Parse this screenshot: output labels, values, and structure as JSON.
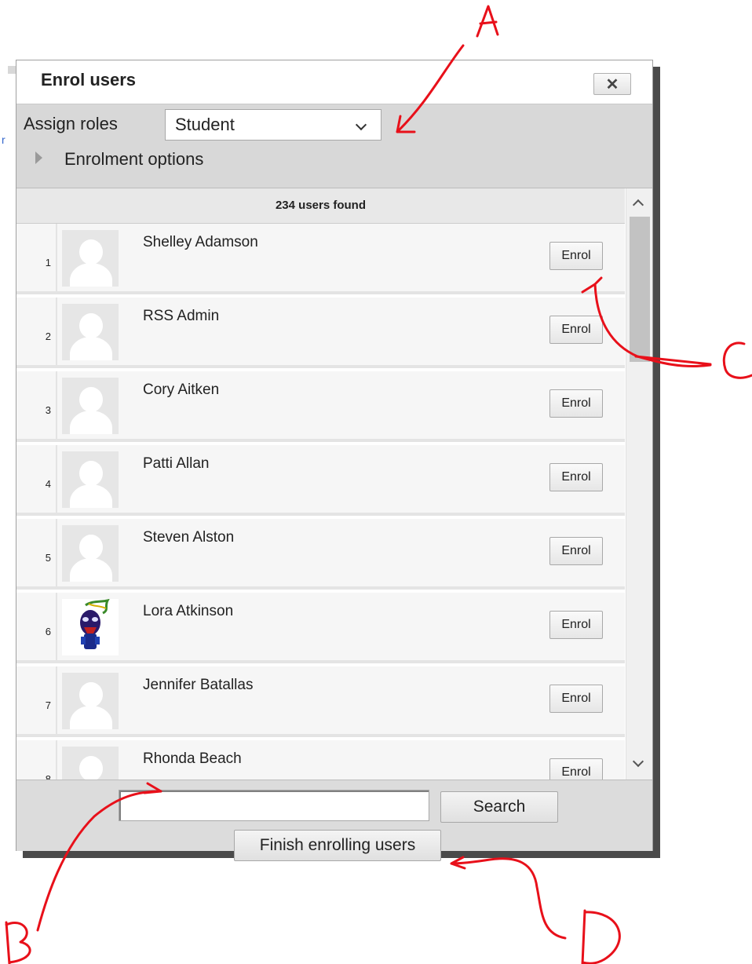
{
  "dialog": {
    "title": "Enrol users",
    "close_label": "✕"
  },
  "options": {
    "roles_label": "Assign roles",
    "roles_selected": "Student",
    "enrolment_options_label": "Enrolment options"
  },
  "list": {
    "found_label": "234 users found",
    "enrol_label": "Enrol",
    "users": [
      {
        "index": "1",
        "name": "Shelley Adamson",
        "avatar": "default-avatar"
      },
      {
        "index": "2",
        "name": "RSS Admin",
        "avatar": "default-avatar"
      },
      {
        "index": "3",
        "name": "Cory Aitken",
        "avatar": "default-avatar"
      },
      {
        "index": "4",
        "name": "Patti Allan",
        "avatar": "default-avatar"
      },
      {
        "index": "5",
        "name": "Steven Alston",
        "avatar": "default-avatar"
      },
      {
        "index": "6",
        "name": "Lora Atkinson",
        "avatar": "custom-character-avatar"
      },
      {
        "index": "7",
        "name": "Jennifer Batallas",
        "avatar": "default-avatar"
      },
      {
        "index": "8",
        "name": "Rhonda Beach",
        "avatar": "default-avatar"
      }
    ]
  },
  "footer": {
    "search_value": "",
    "search_label": "Search",
    "finish_label": "Finish enrolling users"
  },
  "annotations": {
    "a": "A",
    "b": "B",
    "c": "C",
    "d": "D",
    "ink_color": "#e8101a"
  }
}
